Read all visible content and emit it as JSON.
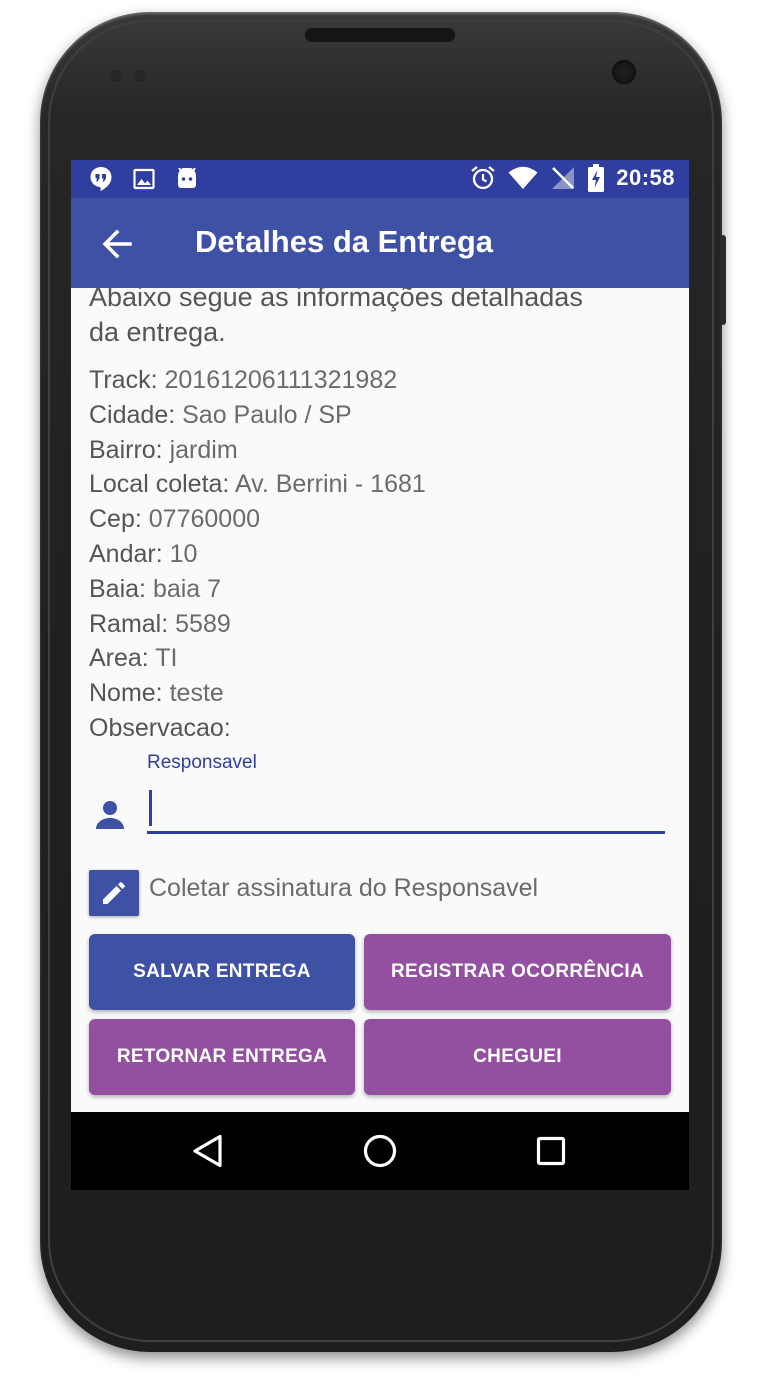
{
  "status_bar": {
    "time": "20:58",
    "left_icons": [
      "hangouts-icon",
      "image-icon",
      "android-icon"
    ],
    "right_icons": [
      "alarm-icon",
      "wifi-icon",
      "no-signal-icon",
      "battery-charging-icon"
    ]
  },
  "app_bar": {
    "title": "Detalhes da Entrega",
    "back_icon": "arrow-back-icon",
    "color": "#3f51a5"
  },
  "intro_text_partial": "Abaixo segue as informações detalhadas",
  "intro_text_end": "da entrega.",
  "details": [
    {
      "label": "Track:",
      "value": "20161206111321982"
    },
    {
      "label": "Cidade:",
      "value": "Sao Paulo / SP"
    },
    {
      "label": "Bairro:",
      "value": "jardim"
    },
    {
      "label": "Local coleta:",
      "value": "Av. Berrini - 1681"
    },
    {
      "label": "Cep:",
      "value": "07760000"
    },
    {
      "label": "Andar:",
      "value": "10"
    },
    {
      "label": "Baia:",
      "value": "baia 7"
    },
    {
      "label": "Ramal:",
      "value": "5589"
    },
    {
      "label": "Area:",
      "value": "TI"
    },
    {
      "label": "Nome:",
      "value": "teste"
    },
    {
      "label": "Observacao:",
      "value": ""
    }
  ],
  "responsavel_field": {
    "label": "Responsavel",
    "value": "",
    "icon": "person-icon"
  },
  "signature": {
    "label": "Coletar assinatura do Responsavel",
    "icon": "pencil-icon"
  },
  "buttons": {
    "salvar": "SALVAR ENTREGA",
    "ocorrencia": "REGISTRAR OCORRÊNCIA",
    "retornar": "RETORNAR ENTREGA",
    "cheguei": "CHEGUEI"
  },
  "colors": {
    "primary": "#3f51a5",
    "primary_dark": "#303f9f",
    "accent": "#9450a0"
  },
  "nav_bar": [
    "back-triangle-icon",
    "home-circle-icon",
    "recents-square-icon"
  ]
}
